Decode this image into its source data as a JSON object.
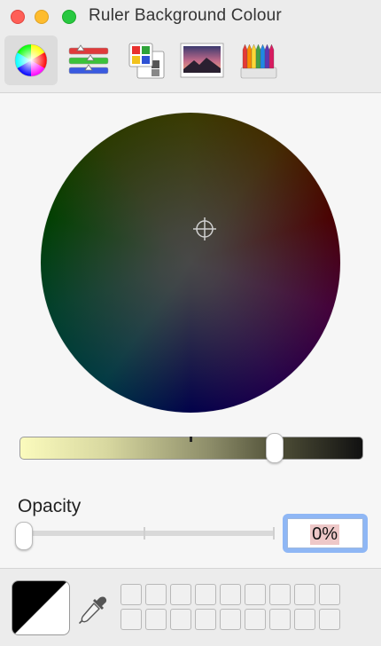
{
  "window": {
    "title": "Ruler Background Colour"
  },
  "toolbar": {
    "tabs": [
      {
        "icon": "color-wheel-icon",
        "active": true
      },
      {
        "icon": "color-sliders-icon",
        "active": false
      },
      {
        "icon": "color-palettes-icon",
        "active": false
      },
      {
        "icon": "image-palettes-icon",
        "active": false
      },
      {
        "icon": "pencils-icon",
        "active": false
      }
    ]
  },
  "color_wheel": {
    "brightness_level_percent": 75
  },
  "opacity": {
    "label": "Opacity",
    "value": "0%",
    "level_percent": 0
  },
  "colors": {
    "current_swatch": [
      "#000000",
      "#ffffff"
    ],
    "focus_ring": "#8fb7f5"
  },
  "swatches": {
    "rows": 2,
    "columns": 9
  }
}
